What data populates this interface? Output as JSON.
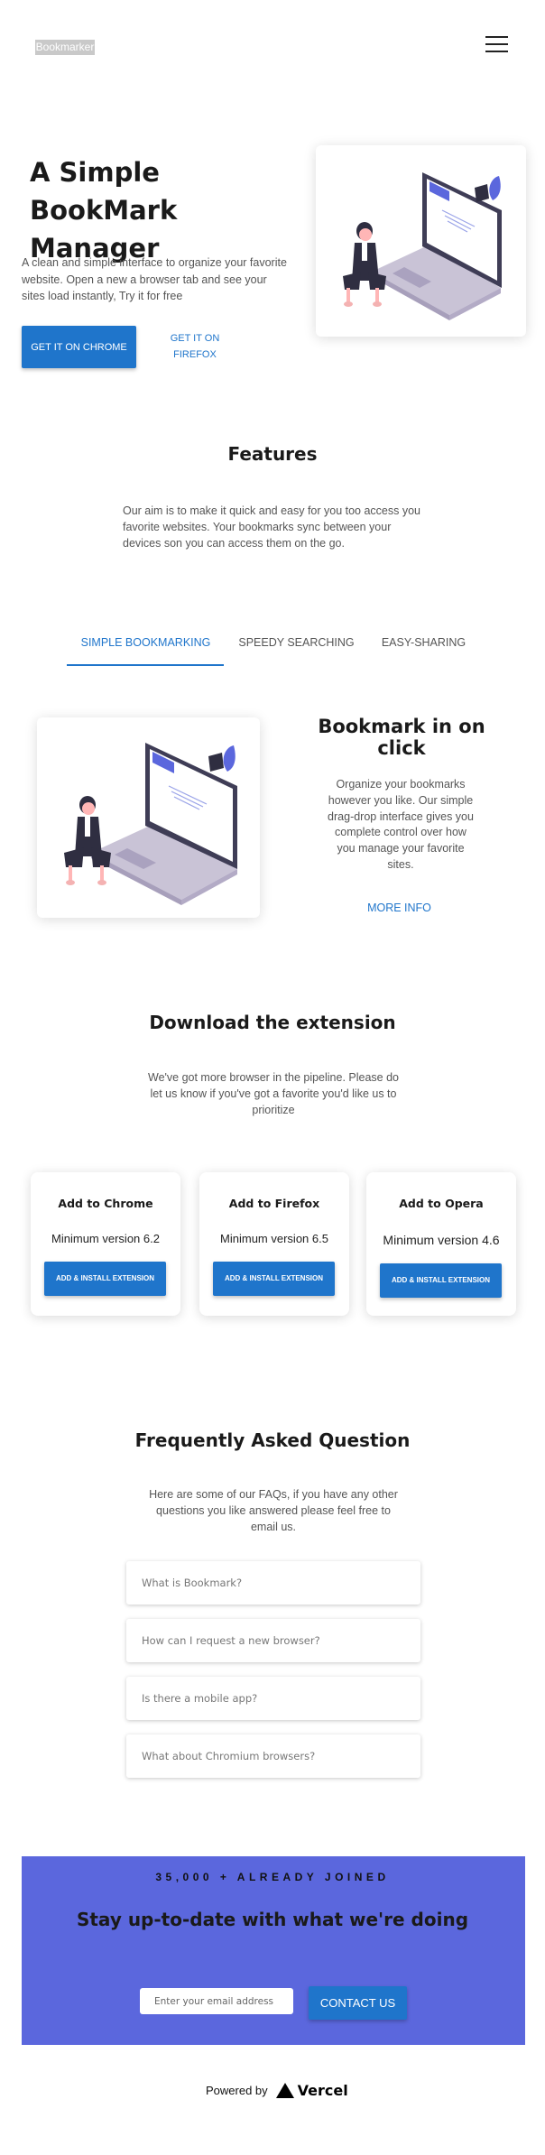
{
  "header": {
    "logo_text": "Bookmarker",
    "menu_icon": "hamburger-menu-icon"
  },
  "hero": {
    "title": "A Simple BookMark Manager",
    "text": "A clean and simple interface to organize your favorite website. Open a new a browser tab and see your sites load instantly, Try it for free",
    "chrome_button": "GET IT ON CHROME",
    "firefox_button": "GET IT ON FIREFOX"
  },
  "features": {
    "title": "Features",
    "text": "Our aim is to make it quick and easy for you too access you favorite websites. Your bookmarks sync between your devices son you can access them on the go.",
    "tabs": [
      {
        "label": "SIMPLE BOOKMARKING"
      },
      {
        "label": "SPEEDY SEARCHING"
      },
      {
        "label": "EASY-SHARING"
      }
    ],
    "panel_title": "Bookmark in on click",
    "panel_text": "Organize your bookmarks however you like. Our simple drag-drop interface gives you complete control over how you manage your favorite sites.",
    "more_info": "MORE INFO"
  },
  "download": {
    "title": "Download the extension",
    "text": "We've got more browser in the pipeline. Please do let us know if you've got a favorite you'd like us to prioritize",
    "cards": [
      {
        "title": "Add to Chrome",
        "version": "Minimum version 6.2",
        "button": "ADD & INSTALL EXTENSION"
      },
      {
        "title": "Add to Firefox",
        "version": "Minimum version 6.5",
        "button": "ADD & INSTALL EXTENSION"
      },
      {
        "title": "Add to Opera",
        "version": "Minimum version 4.6",
        "button": "ADD & INSTALL EXTENSION"
      }
    ]
  },
  "faq": {
    "title": "Frequently Asked Question",
    "text": "Here are some of our FAQs, if you have any other questions you like answered please feel free to email us.",
    "items": [
      {
        "question": "What is Bookmark?"
      },
      {
        "question": "How can I request a new browser?"
      },
      {
        "question": "Is there a mobile app?"
      },
      {
        "question": "What about Chromium browsers?"
      }
    ]
  },
  "newsletter": {
    "count": "35,000 + ALREADY JOINED",
    "title": "Stay up-to-date with what we're doing",
    "email_placeholder": "Enter your email address",
    "button": "CONTACT US"
  },
  "footer": {
    "powered_by": "Powered by",
    "brand": "Vercel"
  },
  "colors": {
    "primary": "#1f75cb",
    "newsletter_bg": "#5b67dd",
    "illustration_accent": "#5b67dd"
  }
}
